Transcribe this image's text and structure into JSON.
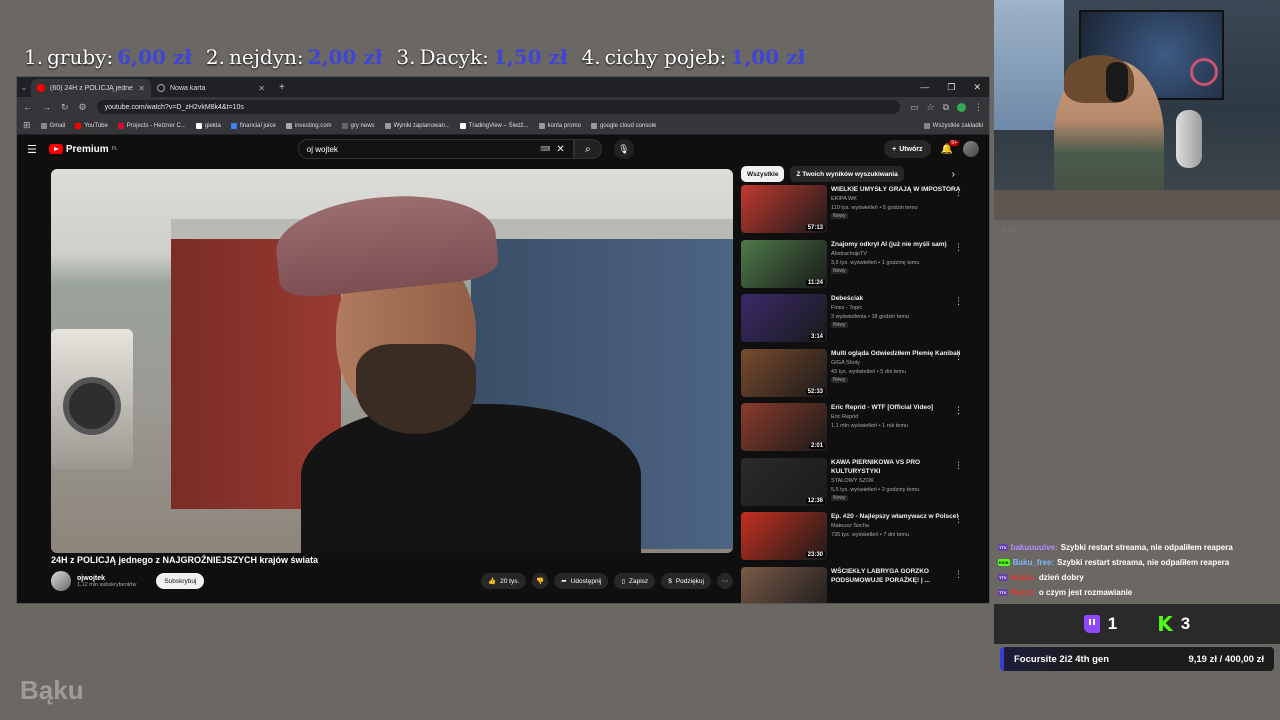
{
  "leaderboard": [
    {
      "rank": "1.",
      "name": "gruby:",
      "amount": "6,00 zł"
    },
    {
      "rank": "2.",
      "name": "nejdyn:",
      "amount": "2,00 zł"
    },
    {
      "rank": "3.",
      "name": "Dacyk:",
      "amount": "1,50 zł"
    },
    {
      "rank": "4.",
      "name": "cichy pojeb:",
      "amount": "1,00 zł"
    }
  ],
  "watermark": "Bąku",
  "browser": {
    "tabs": [
      {
        "title": "(60) 24H z POLICJĄ jednego z N",
        "active": true
      },
      {
        "title": "Nowa karta",
        "active": false
      }
    ],
    "url": "youtube.com/watch?v=D_zH2vkM8k4&t=10s",
    "bookmarks": [
      "Gmail",
      "YouTube",
      "Projects - Hetzner C...",
      "giełda",
      "financial juice",
      "investing.com",
      "gry news",
      "Wyniki zaplanowan...",
      "TradingView – Śledź...",
      "konta promo",
      "google cloud console"
    ],
    "all_bookmarks": "Wszystkie zakładki"
  },
  "youtube": {
    "logo_text": "Premium",
    "logo_sup": "PL",
    "search_query": "oj wojtek",
    "create_label": "Utwórz",
    "notif_count": "9+",
    "video_title": "24H z POLICJĄ jednego z NAJGROŹNIEJSZYCH krajów świata",
    "channel_name": "ojwojtek",
    "channel_subs": "1,12 mln subskrybentów",
    "subscribe_label": "Subskrybuj",
    "likes": "20 tys.",
    "share_label": "Udostępnij",
    "save_label": "Zapisz",
    "thanks_label": "Podziękuj",
    "chips": [
      "Wszystkie",
      "Z Twoich wyników wyszukiwania"
    ],
    "recommendations": [
      {
        "title": "WIELKIE UMYSŁY GRAJĄ W IMPOSTORA",
        "channel": "EKIPA WK",
        "meta": "110 tys. wyświetleń • 5 godzin temu",
        "badge": "Nowy",
        "duration": "57:13",
        "color": "#c23a2f"
      },
      {
        "title": "Znajomy odkrył AI (już nie myśli sam)",
        "channel": "AbstrachujeTV",
        "meta": "3,6 tys. wyświetleń • 1 godzinę temu",
        "badge": "Nowy",
        "duration": "11:24",
        "color": "#4e7a4a"
      },
      {
        "title": "Debeściak",
        "channel": "Finez - Topic",
        "meta": "3 wyświetlenia • 18 godzin temu",
        "badge": "Nowy",
        "duration": "3:14",
        "color": "#3a2a6a"
      },
      {
        "title": "Multi ogląda Odwiedziłem Plemię Kanibali",
        "channel": "GIGA Shoty",
        "meta": "43 tys. wyświetleń • 5 dni temu",
        "badge": "Nowy",
        "duration": "52:33",
        "color": "#7a4b2e"
      },
      {
        "title": "Eric Reprid - WTF [Official Video]",
        "channel": "Eric Reprid",
        "meta": "1,1 mln wyświetleń • 1 rok temu",
        "badge": "",
        "duration": "2:01",
        "color": "#8a3c2c"
      },
      {
        "title": "KAWA PIERNIKOWA VS PRO KULTURYSTYKI",
        "channel": "STALOWY SZOK",
        "meta": "5,5 tys. wyświetleń • 2 godziny temu",
        "badge": "Nowy",
        "duration": "12:36",
        "color": "#2b2b2b"
      },
      {
        "title": "Ep. #20 - Najlepszy włamywacz w Polsce!",
        "channel": "Mateusz Socha",
        "meta": "735 tys. wyświetleń • 7 dni temu",
        "badge": "",
        "duration": "23:30",
        "color": "#c5301f"
      },
      {
        "title": "WŚCIEKŁY LABRYGA GORZKO PODSUMOWUJE PORAŻKĘ! | ...",
        "channel": "",
        "meta": "",
        "badge": "",
        "duration": "",
        "color": "#7a5a48"
      }
    ]
  },
  "overlay": {
    "chat_label": "CHAT",
    "chat": [
      {
        "platform": "TTV",
        "user": "bakuuuuive:",
        "user_color": "#b28bff",
        "text": "Szybki restart streama, nie odpaliłem reapera"
      },
      {
        "platform": "KICK",
        "user": "Baku_free:",
        "user_color": "#7fb7ff",
        "text": "Szybki restart streama, nie odpaliłem reapera"
      },
      {
        "platform": "TTV",
        "user": "Huzzz:",
        "user_color": "#e8332a",
        "text": "dzień dobry"
      },
      {
        "platform": "TTV",
        "user": "Huzzz:",
        "user_color": "#e8332a",
        "text": "o czym jest rozmawianie"
      }
    ],
    "twitch_viewers": "1",
    "kick_viewers": "3",
    "now_playing_name": "Focursite 2i2 4th gen",
    "now_playing_price": "9,19 zł / 400,00 zł"
  }
}
